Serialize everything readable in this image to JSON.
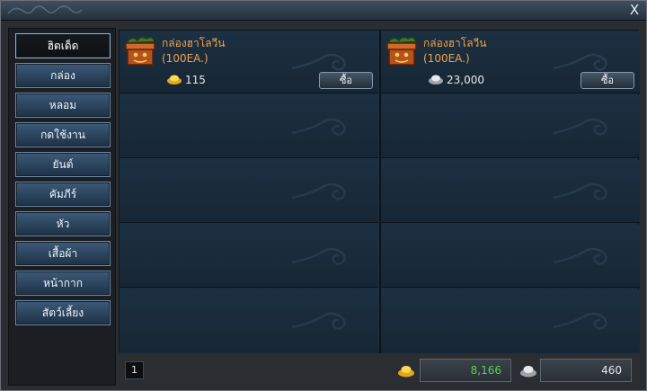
{
  "window": {
    "close_label": "X"
  },
  "sidebar": {
    "items": [
      {
        "label": "ฮิตเด็ด",
        "active": true
      },
      {
        "label": "กล่อง",
        "active": false
      },
      {
        "label": "หลอม",
        "active": false
      },
      {
        "label": "กดใช้งาน",
        "active": false
      },
      {
        "label": "ยันต์",
        "active": false
      },
      {
        "label": "คัมภีร์",
        "active": false
      },
      {
        "label": "หัว",
        "active": false
      },
      {
        "label": "เสื้อผ้า",
        "active": false
      },
      {
        "label": "หน้ากาก",
        "active": false
      },
      {
        "label": "สัตว์เลี้ยง",
        "active": false
      }
    ]
  },
  "shop": {
    "items": [
      {
        "name": "กล่องฮาโลวีน",
        "qty": "(100EA.)",
        "currency": "gold-ingot-icon",
        "price": "115",
        "buy_label": "ซื้อ"
      },
      {
        "name": "กล่องฮาโลวีน",
        "qty": "(100EA.)",
        "currency": "silver-ingot-icon",
        "price": "23,000",
        "buy_label": "ซื้อ"
      }
    ]
  },
  "footer": {
    "page": "1",
    "gold_balance": "8,166",
    "silver_balance": "460"
  },
  "colors": {
    "item_name": "#f0a24a",
    "gold_balance": "#57d15a",
    "panel": "#1c2f40"
  }
}
